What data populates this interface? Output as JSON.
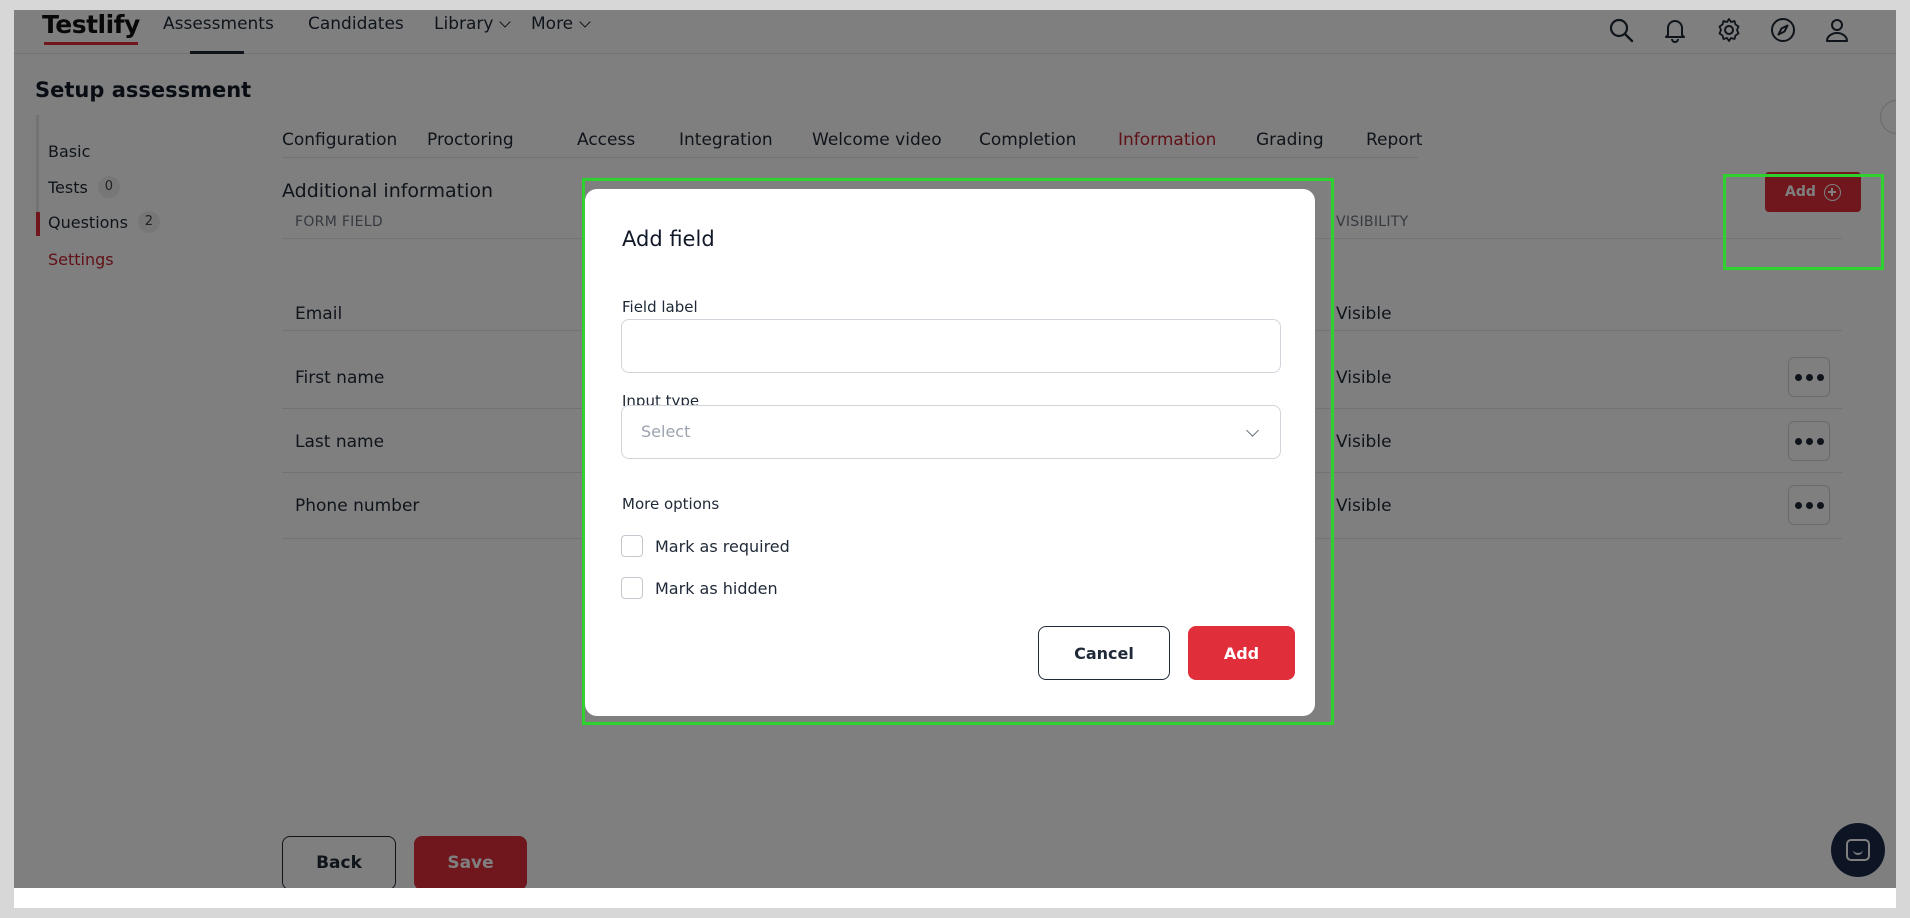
{
  "app": {
    "logo": "Testlify",
    "nav": [
      {
        "label": "Assessments"
      },
      {
        "label": "Candidates"
      },
      {
        "label": "Library"
      },
      {
        "label": "More"
      }
    ],
    "header_icons": [
      "search-icon",
      "bell-icon",
      "gear-icon",
      "compass-icon",
      "user-icon"
    ]
  },
  "page": {
    "title": "Setup assessment",
    "sidebar": [
      {
        "label": "Basic"
      },
      {
        "label": "Tests",
        "count": "0"
      },
      {
        "label": "Questions",
        "count": "2"
      },
      {
        "label": "Settings"
      }
    ],
    "tabs": [
      "Configuration",
      "Proctoring",
      "Access",
      "Integration",
      "Welcome video",
      "Completion",
      "Information",
      "Grading",
      "Report"
    ],
    "active_tab": "Information",
    "section_title": "Additional information",
    "table": {
      "headers": {
        "form_field": "FORM FIELD",
        "visibility": "VISIBILITY"
      },
      "rows": [
        {
          "field": "Email",
          "visibility": "Visible"
        },
        {
          "field": "First name",
          "visibility": "Visible"
        },
        {
          "field": "Last name",
          "visibility": "Visible"
        },
        {
          "field": "Phone number",
          "visibility": "Visible"
        }
      ]
    },
    "add_button": "Add",
    "back_button": "Back",
    "save_button": "Save"
  },
  "modal": {
    "title": "Add field",
    "field_label": {
      "label": "Field label",
      "value": "",
      "placeholder": ""
    },
    "input_type": {
      "label": "Input type",
      "placeholder": "Select"
    },
    "more_options_label": "More options",
    "options": [
      {
        "label": "Mark as required",
        "checked": false
      },
      {
        "label": "Mark as hidden",
        "checked": false
      }
    ],
    "cancel_button": "Cancel",
    "add_button": "Add"
  },
  "colors": {
    "accent": "#e02f3a",
    "highlight": "#2fd12f",
    "overlay": "rgba(0,0,0,0.5)"
  }
}
